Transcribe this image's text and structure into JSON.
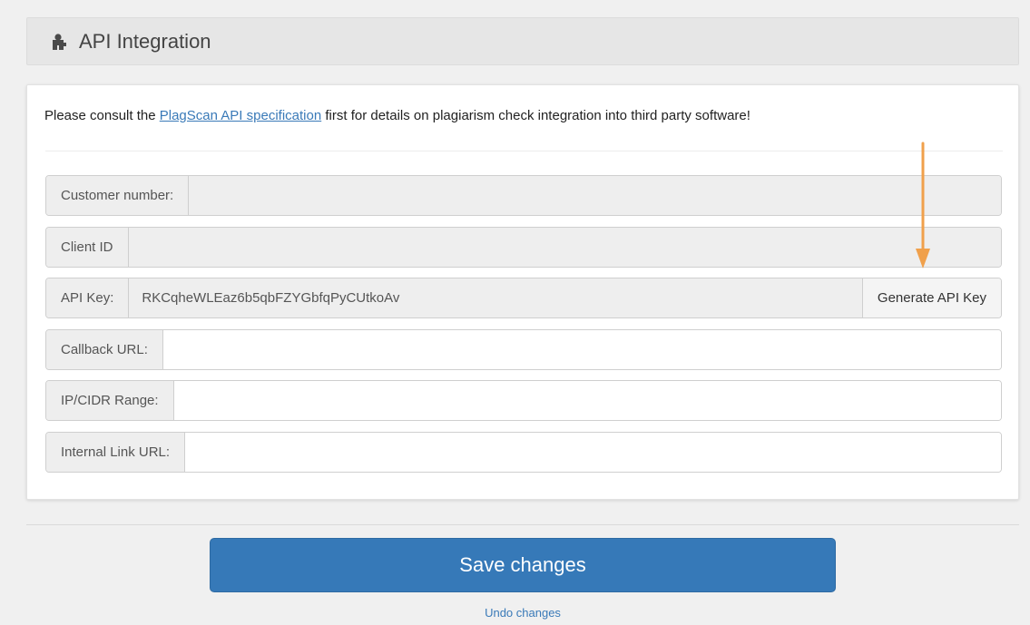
{
  "header": {
    "title": "API Integration",
    "icon": "puzzle-icon"
  },
  "intro": {
    "before": "Please consult the ",
    "link_text": "PlagScan API specification",
    "after": " first for details on plagiarism check integration into third party software!"
  },
  "fields": {
    "customer_number": {
      "label": "Customer number:",
      "value": ""
    },
    "client_id": {
      "label": "Client ID",
      "value": ""
    },
    "api_key": {
      "label": "API Key:",
      "value": "RKCqheWLEaz6b5qbFZYGbfqPyCUtkoAv",
      "button_label": "Generate API Key"
    },
    "callback_url": {
      "label": "Callback URL:",
      "value": ""
    },
    "ip_cidr_range": {
      "label": "IP/CIDR Range:",
      "value": ""
    },
    "internal_link_url": {
      "label": "Internal Link URL:",
      "value": ""
    }
  },
  "actions": {
    "save_label": "Save changes",
    "undo_label": "Undo changes"
  },
  "colors": {
    "primary": "#3679b8",
    "link": "#3a7ab8",
    "annotation_arrow": "#f0a04b"
  }
}
